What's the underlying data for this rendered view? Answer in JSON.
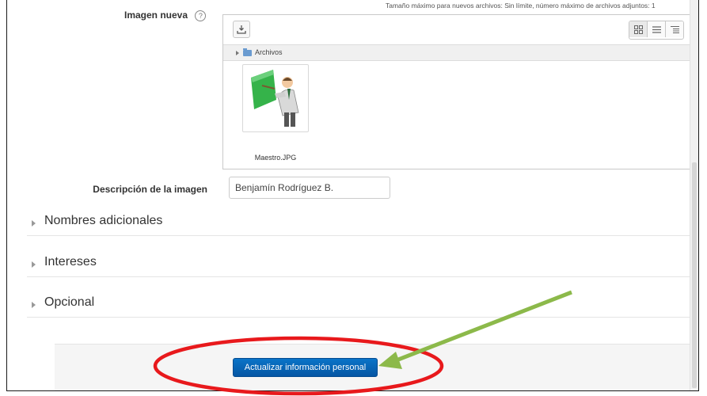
{
  "image_field": {
    "label": "Imagen nueva",
    "help_icon": "question-circle-icon",
    "max_size_note": "Tamaño máximo para nuevos archivos: Sin límite, número máximo de archivos adjuntos: 1"
  },
  "filepicker": {
    "upload_icon": "download-tray-icon",
    "view_icons": [
      "grid-view-icon",
      "list-view-icon",
      "tree-view-icon"
    ],
    "path_folder": "Archivos",
    "files": [
      {
        "name": "Maestro.JPG",
        "thumbnail_icon": "teacher-pointing-icon"
      }
    ]
  },
  "description": {
    "label": "Descripción de la imagen",
    "value": "Benjamín Rodríguez B."
  },
  "sections": [
    {
      "title": "Nombres adicionales"
    },
    {
      "title": "Intereses"
    },
    {
      "title": "Opcional"
    }
  ],
  "submit": {
    "label": "Actualizar información personal"
  },
  "annotation_colors": {
    "ellipse": "#e8191c",
    "arrow": "#8cb94a"
  }
}
